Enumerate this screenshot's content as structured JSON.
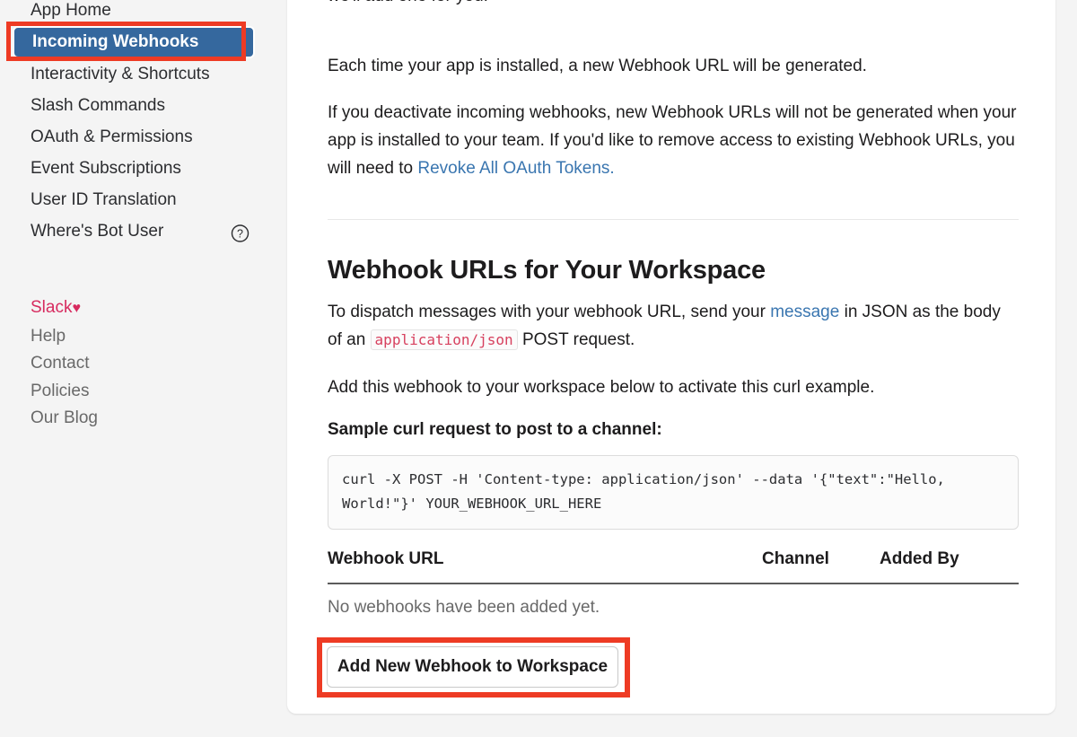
{
  "sidebar": {
    "nav_items": [
      {
        "label": "App Home",
        "active": false,
        "help_icon": null
      },
      {
        "label": "Incoming Webhooks",
        "active": true,
        "help_icon": null
      },
      {
        "label": "Interactivity & Shortcuts",
        "active": false,
        "help_icon": null
      },
      {
        "label": "Slash Commands",
        "active": false,
        "help_icon": null
      },
      {
        "label": "OAuth & Permissions",
        "active": false,
        "help_icon": null
      },
      {
        "label": "Event Subscriptions",
        "active": false,
        "help_icon": null
      },
      {
        "label": "User ID Translation",
        "active": false,
        "help_icon": null
      },
      {
        "label": "Where's Bot User",
        "active": false,
        "help_icon": "question-circle-icon"
      }
    ],
    "footer_links": [
      {
        "label": "Slack",
        "heart": "♥",
        "brand": true
      },
      {
        "label": "Help",
        "brand": false
      },
      {
        "label": "Contact",
        "brand": false
      },
      {
        "label": "Policies",
        "brand": false
      },
      {
        "label": "Our Blog",
        "brand": false
      }
    ]
  },
  "content": {
    "para_top_tail": "we'll add one for you.",
    "para_each": "Each time your app is installed, a new Webhook URL will be generated.",
    "para_deactivate_pre": "If you deactivate incoming webhooks, new Webhook URLs will not be generated when your app is installed to your team. If you'd like to remove access to existing Webhook URLs, you will need to ",
    "revoke_link": "Revoke All OAuth Tokens.",
    "section_title": "Webhook URLs for Your Workspace",
    "dispatch_pre": "To dispatch messages with your webhook URL, send your ",
    "message_link": "message",
    "dispatch_mid": " in JSON as the body of an ",
    "inline_code": "application/json",
    "dispatch_post": " POST request.",
    "para_add": "Add this webhook to your workspace below to activate this curl example.",
    "code_label": "Sample curl request to post to a channel:",
    "curl_command": "curl -X POST -H 'Content-type: application/json' --data '{\"text\":\"Hello, World!\"}' YOUR_WEBHOOK_URL_HERE",
    "table": {
      "headers": [
        "Webhook URL",
        "Channel",
        "Added By"
      ],
      "empty_message": "No webhooks have been added yet."
    },
    "add_button": "Add New Webhook to Workspace"
  },
  "annotations": {
    "highlight_color": "#ee3b24",
    "active_nav_color": "#35689e",
    "link_color": "#3a76b0",
    "code_color": "#d7405e"
  }
}
